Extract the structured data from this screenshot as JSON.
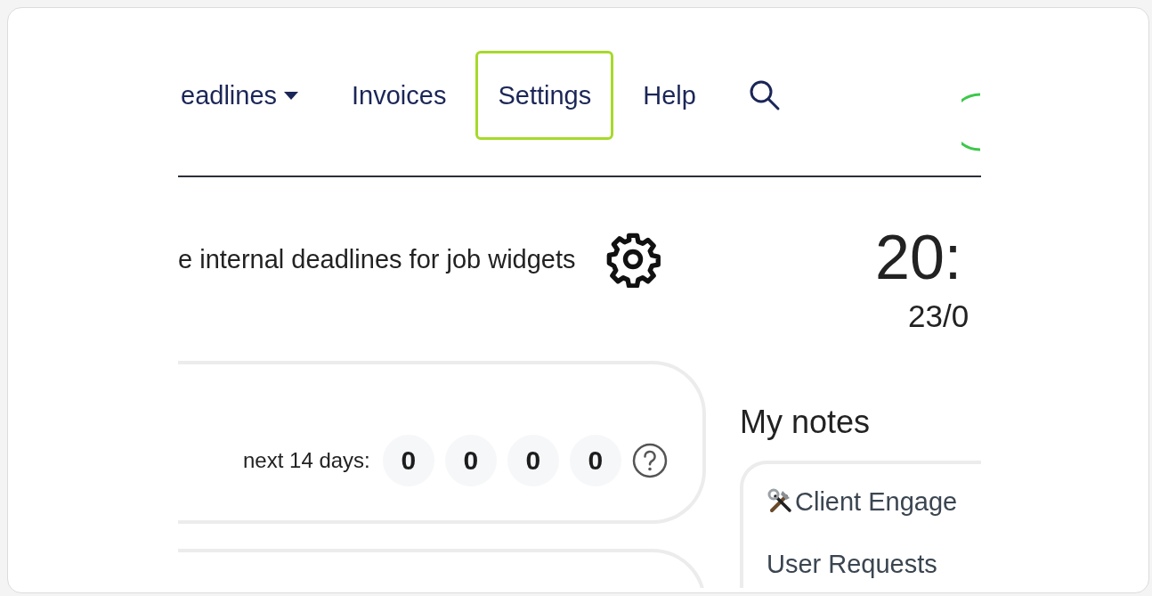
{
  "nav": {
    "items": [
      {
        "label": "eadlines",
        "dropdown": true,
        "highlighted": false
      },
      {
        "label": "Invoices",
        "dropdown": false,
        "highlighted": false
      },
      {
        "label": "Settings",
        "dropdown": false,
        "highlighted": true
      },
      {
        "label": "Help",
        "dropdown": false,
        "highlighted": false
      }
    ]
  },
  "widget_settings": {
    "text": "e internal deadlines for job widgets"
  },
  "clock": {
    "time": "20:",
    "date": "23/0"
  },
  "deadlines_card": {
    "label": "next 14 days:",
    "counts": [
      "0",
      "0",
      "0",
      "0"
    ]
  },
  "notes": {
    "title": "My notes",
    "items": [
      {
        "title": "Client Engage",
        "kind": "tools"
      },
      {
        "title": "User Requests",
        "kind": "plain"
      }
    ]
  }
}
